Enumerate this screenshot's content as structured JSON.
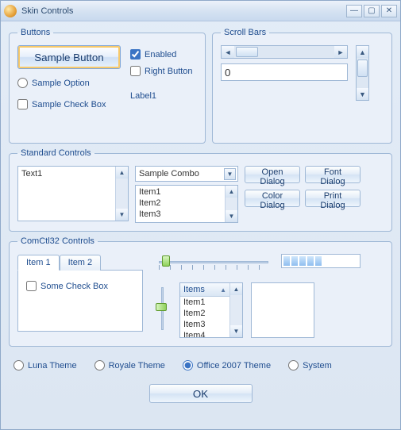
{
  "window": {
    "title": "Skin Controls"
  },
  "groups": {
    "buttons": "Buttons",
    "scrollbars": "Scroll Bars",
    "standard": "Standard Controls",
    "comctl": "ComCtl32 Controls"
  },
  "buttons_group": {
    "sample_button": "Sample Button",
    "enabled": "Enabled",
    "enabled_checked": true,
    "right_button": "Right Button",
    "right_button_checked": false,
    "sample_option": "Sample Option",
    "sample_checkbox": "Sample Check Box",
    "label1": "Label1"
  },
  "scrollbars_group": {
    "numeric_value": "0"
  },
  "standard_group": {
    "textarea_value": "Text1",
    "combo_value": "Sample Combo",
    "list_items": [
      "Item1",
      "Item2",
      "Item3"
    ],
    "open_dialog": "Open Dialog",
    "font_dialog": "Font Dialog",
    "color_dialog": "Color Dialog",
    "print_dialog": "Print Dialog"
  },
  "comctl_group": {
    "tabs": [
      "Item 1",
      "Item 2"
    ],
    "active_tab": 0,
    "some_checkbox": "Some Check Box",
    "listview_header": "Items",
    "listview_items": [
      "Item1",
      "Item2",
      "Item3",
      "Item4"
    ]
  },
  "themes": {
    "luna": "Luna Theme",
    "royale": "Royale Theme",
    "office2007": "Office 2007 Theme",
    "system": "System",
    "selected": "office2007"
  },
  "ok": "OK"
}
